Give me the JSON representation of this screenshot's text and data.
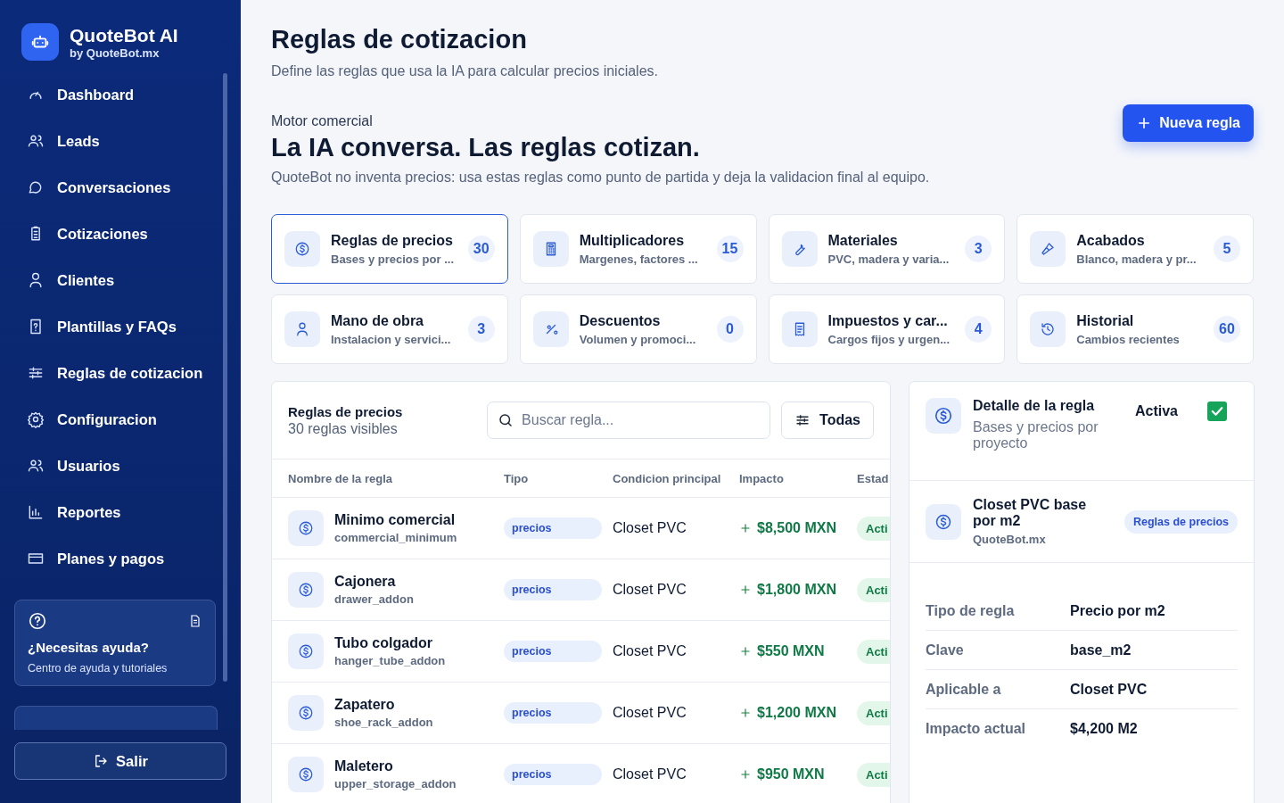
{
  "sidebar": {
    "brand": {
      "name": "QuoteBot AI",
      "byline": "by QuoteBot.mx"
    },
    "nav": [
      "Dashboard",
      "Leads",
      "Conversaciones",
      "Cotizaciones",
      "Clientes",
      "Plantillas y FAQs",
      "Reglas de cotizacion",
      "Configuracion",
      "Usuarios",
      "Reportes",
      "Planes y pagos"
    ],
    "help": {
      "title": "¿Necesitas ayuda?",
      "text": "Centro de ayuda y tutoriales"
    },
    "logout": "Salir"
  },
  "header": {
    "title": "Reglas de cotizacion",
    "subtitle": "Define las reglas que usa la IA para calcular precios iniciales."
  },
  "hero": {
    "eyebrow": "Motor comercial",
    "title": "La IA conversa. Las reglas cotizan.",
    "text": "QuoteBot no inventa precios: usa estas reglas como punto de partida y deja la validacion final al equipo.",
    "button": "Nueva regla"
  },
  "categories": [
    {
      "title": "Reglas de precios",
      "subtitle": "Bases y precios por ...",
      "count": "30",
      "selected": true
    },
    {
      "title": "Multiplicadores",
      "subtitle": "Margenes, factores ...",
      "count": "15",
      "selected": false
    },
    {
      "title": "Materiales",
      "subtitle": "PVC, madera y varia...",
      "count": "3",
      "selected": false
    },
    {
      "title": "Acabados",
      "subtitle": "Blanco, madera y pr...",
      "count": "5",
      "selected": false
    },
    {
      "title": "Mano de obra",
      "subtitle": "Instalacion y servici...",
      "count": "3",
      "selected": false
    },
    {
      "title": "Descuentos",
      "subtitle": "Volumen y promoci...",
      "count": "0",
      "selected": false
    },
    {
      "title": "Impuestos y car...",
      "subtitle": "Cargos fijos y urgen...",
      "count": "4",
      "selected": false
    },
    {
      "title": "Historial",
      "subtitle": "Cambios recientes",
      "count": "60",
      "selected": false
    }
  ],
  "table": {
    "title": "Reglas de precios",
    "count": "30 reglas visibles",
    "search": {
      "placeholder": "Buscar regla..."
    },
    "filter": "Todas",
    "columns": [
      "Nombre de la regla",
      "Tipo",
      "Condicion principal",
      "Impacto",
      "Estad"
    ],
    "rows": [
      {
        "name": "Minimo comercial",
        "key": "commercial_minimum",
        "type": "precios",
        "condition": "Closet PVC",
        "impact": "$8,500 MXN",
        "status": "Acti"
      },
      {
        "name": "Cajonera",
        "key": "drawer_addon",
        "type": "precios",
        "condition": "Closet PVC",
        "impact": "$1,800 MXN",
        "status": "Acti"
      },
      {
        "name": "Tubo colgador",
        "key": "hanger_tube_addon",
        "type": "precios",
        "condition": "Closet PVC",
        "impact": "$550 MXN",
        "status": "Acti"
      },
      {
        "name": "Zapatero",
        "key": "shoe_rack_addon",
        "type": "precios",
        "condition": "Closet PVC",
        "impact": "$1,200 MXN",
        "status": "Acti"
      },
      {
        "name": "Maletero",
        "key": "upper_storage_addon",
        "type": "precios",
        "condition": "Closet PVC",
        "impact": "$950 MXN",
        "status": "Acti"
      }
    ]
  },
  "detail": {
    "title": "Detalle de la regla",
    "subtitle": "Bases y precios por proyecto",
    "active_label": "Activa",
    "checked": true,
    "rule": {
      "name": "Closet PVC base por m2",
      "source": "QuoteBot.mx",
      "badge": "Reglas de precios"
    },
    "fields": [
      {
        "label": "Tipo de regla",
        "value": "Precio por m2"
      },
      {
        "label": "Clave",
        "value": "base_m2"
      },
      {
        "label": "Aplicable a",
        "value": "Closet PVC"
      },
      {
        "label": "Impacto actual",
        "value": "$4,200 M2"
      }
    ]
  }
}
